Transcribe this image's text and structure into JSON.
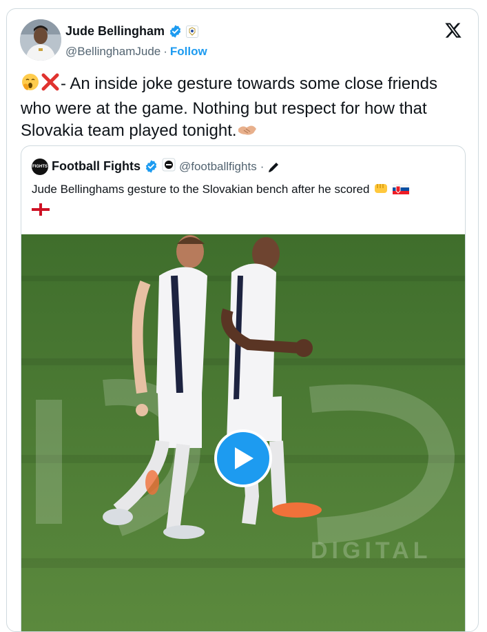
{
  "author": {
    "name": "Jude Bellingham",
    "handle": "@BellinghamJude",
    "separator": "·",
    "follow_label": "Follow"
  },
  "tweet": {
    "text": "- An inside joke gesture towards some close friends who were at the game. Nothing but respect for how that Slovakia team played tonight.",
    "emojis": [
      "yawning-face",
      "cross-mark",
      "handshake"
    ]
  },
  "quote": {
    "name": "Football Fights",
    "avatar_text": "FIGHTS",
    "handle": "@footballfights",
    "separator": "·",
    "text": "Jude Bellinghams gesture to the Slovakian bench after he scored",
    "emojis": [
      "fist",
      "slovakia-flag",
      "england-flag"
    ]
  },
  "media": {
    "watermark": "DIGITAL",
    "icon": "play-icon"
  },
  "colors": {
    "accent": "#1d9bf0",
    "text": "#0f1419",
    "secondary": "#536471",
    "border": "#cfd9de",
    "pitch": "#4a7a34"
  }
}
